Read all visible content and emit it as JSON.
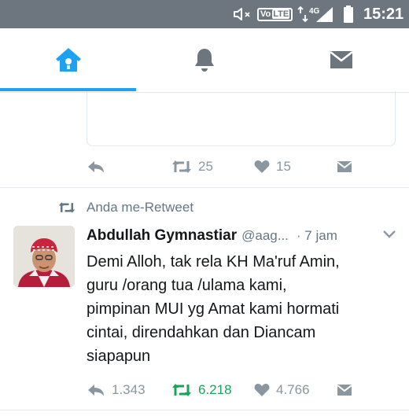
{
  "status_bar": {
    "time": "15:21",
    "volte_prefix": "Vo",
    "volte_suffix": "LTE",
    "network": "4G",
    "icons": [
      "mute-icon",
      "volte-icon",
      "data-arrows-icon",
      "signal-icon",
      "battery-icon"
    ]
  },
  "tabs": [
    {
      "icon": "home-icon",
      "active": true
    },
    {
      "icon": "bell-icon",
      "active": false
    },
    {
      "icon": "envelope-icon",
      "active": false
    }
  ],
  "colors": {
    "status_bar": "#6d767e",
    "accent": "#1da1f2",
    "muted": "#8a96a0",
    "retweet_green": "#19a35a",
    "divider": "#e1e8ed"
  },
  "previous_tweet": {
    "retweets": "25",
    "likes": "15"
  },
  "tweet": {
    "retweet_context": "Anda me-Retweet",
    "author_name": "Abdullah Gymnastiar",
    "author_handle": "@aag...",
    "time": "· 7 jam",
    "text": "Demi Alloh, tak rela KH Ma'ruf Amin,\nguru /orang tua /ulama kami,\npimpinan MUI yg Amat kami hormati\ncintai, direndahkan dan Diancam\nsiapapun",
    "replies": "1.343",
    "retweets": "6.218",
    "likes": "4.766",
    "retweeted": true
  }
}
